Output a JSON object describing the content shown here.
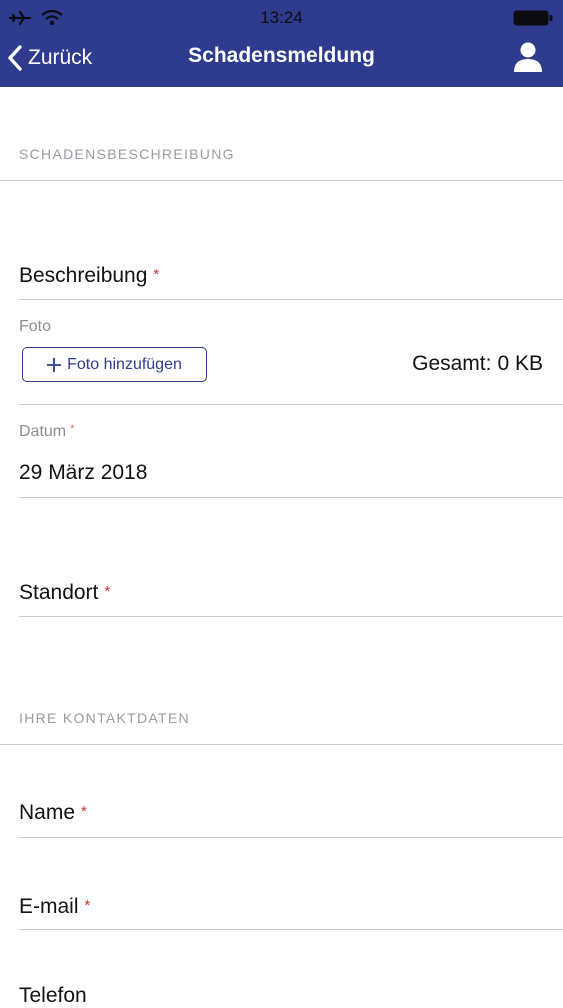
{
  "status_bar": {
    "time": "13:24"
  },
  "nav": {
    "back_label": "Zurück",
    "title": "Schadensmeldung"
  },
  "sections": {
    "damage": "SCHADENSBESCHREIBUNG",
    "contact": "IHRE KONTAKTDATEN"
  },
  "fields": {
    "description": {
      "label": "Beschreibung",
      "required_mark": "*"
    },
    "photo": {
      "label": "Foto",
      "add_button_label": "Foto hinzufügen",
      "total_label": "Gesamt:",
      "total_value": "0 KB"
    },
    "date": {
      "label": "Datum",
      "required_mark": "*",
      "value": "29 März 2018"
    },
    "location": {
      "label": "Standort",
      "required_mark": "*"
    },
    "name": {
      "label": "Name",
      "required_mark": "*"
    },
    "email": {
      "label": "E-mail",
      "required_mark": "*"
    },
    "phone": {
      "label": "Telefon"
    }
  },
  "colors": {
    "accent": "#2f3b8f",
    "required": "#d23434"
  },
  "icons": [
    "airplane-icon",
    "wifi-icon",
    "battery-icon",
    "back-chevron-icon",
    "profile-icon",
    "plus-icon"
  ]
}
